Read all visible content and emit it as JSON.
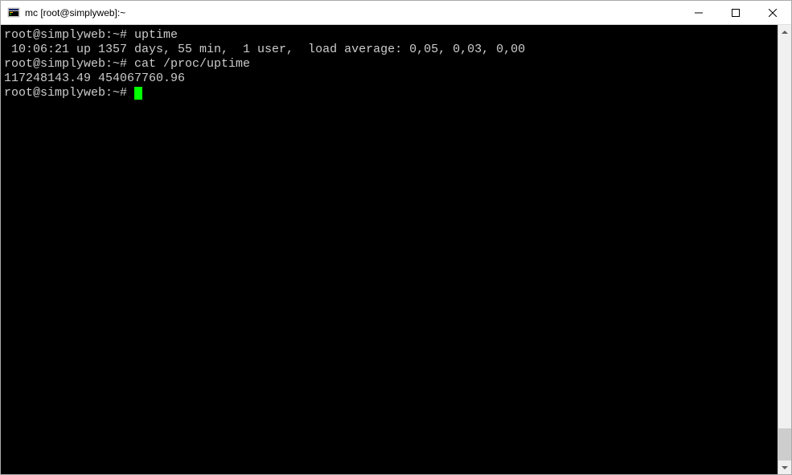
{
  "window": {
    "title": "mc [root@simplyweb]:~"
  },
  "terminal": {
    "lines": [
      {
        "prompt": "root@simplyweb:~# ",
        "command": "uptime"
      },
      {
        "output": " 10:06:21 up 1357 days, 55 min,  1 user,  load average: 0,05, 0,03, 0,00"
      },
      {
        "prompt": "root@simplyweb:~# ",
        "command": "cat /proc/uptime"
      },
      {
        "output": "117248143.49 454067760.96"
      },
      {
        "prompt": "root@simplyweb:~# ",
        "cursor": true
      }
    ]
  }
}
